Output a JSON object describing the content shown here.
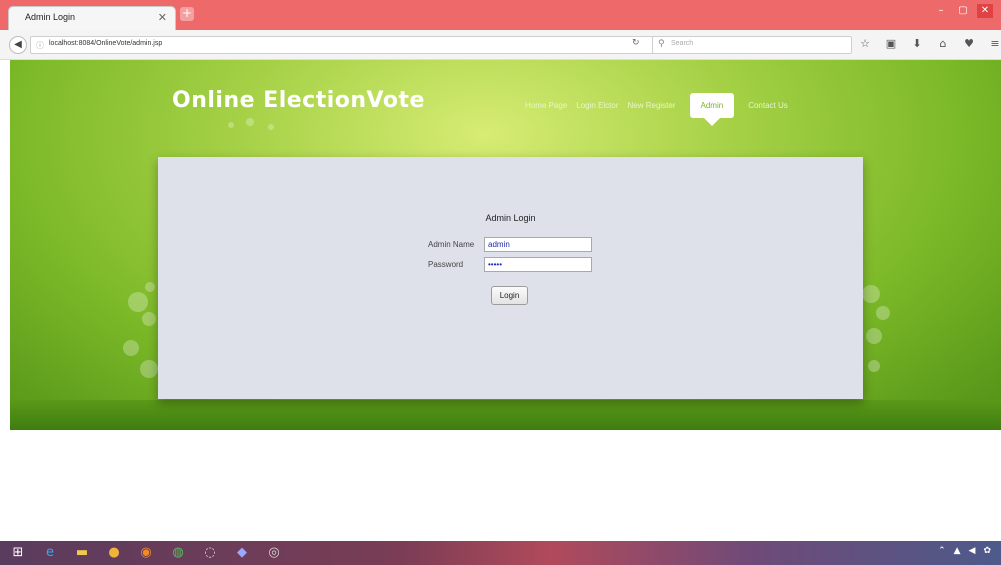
{
  "browser": {
    "tab_title": "Admin Login",
    "tab_close": "✕",
    "new_tab": "+",
    "url": "localhost:8084/OnlineVote/admin.jsp",
    "search_placeholder": "Search",
    "window_buttons": [
      "–",
      "▢",
      "✕"
    ],
    "toolbar_icons": [
      "star-icon",
      "reading-list-icon",
      "download-icon",
      "home-icon",
      "pocket-icon",
      "menu-icon"
    ]
  },
  "site": {
    "title": "Online ElectionVote",
    "nav": [
      {
        "label": "Home Page",
        "active": false
      },
      {
        "label": "Login Elctor",
        "active": false
      },
      {
        "label": "New Register",
        "active": false
      },
      {
        "label": "Admin",
        "active": true
      },
      {
        "label": "Contact Us",
        "active": false
      }
    ],
    "colors": {
      "accent": "#79b427",
      "panel": "#dfe1ea",
      "tab_strip": "#ee6a6a"
    }
  },
  "form": {
    "title": "Admin Login",
    "name_label": "Admin Name",
    "name_value": "admin",
    "password_label": "Password",
    "password_value": "•••••",
    "login_label": "Login"
  },
  "taskbar": {
    "icons": [
      "windows-start-icon",
      "internet-explorer-icon",
      "file-explorer-icon",
      "chrome-icon",
      "firefox-icon",
      "app-icon",
      "app-icon",
      "app-icon",
      "app-icon"
    ]
  }
}
